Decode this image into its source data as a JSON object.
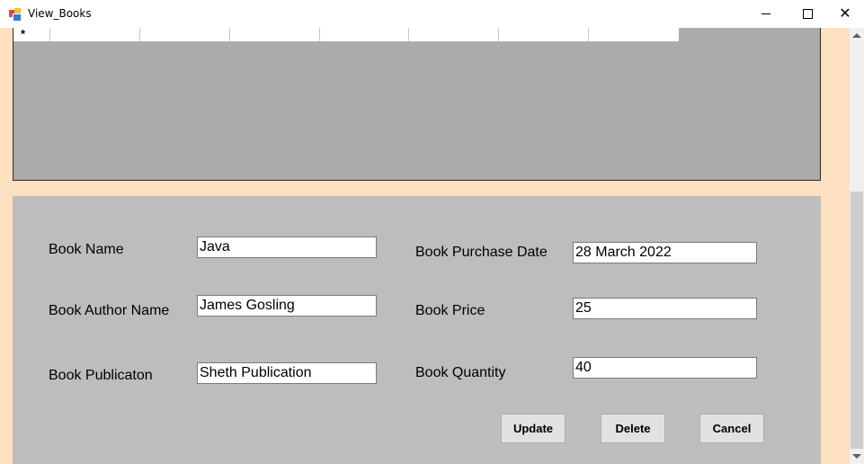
{
  "window": {
    "title": "View_Books"
  },
  "grid": {
    "new_row_marker": "*"
  },
  "form": {
    "book_name_label": "Book Name",
    "book_name_value": "Java",
    "author_label": "Book Author Name",
    "author_value": "James Gosling",
    "publication_label": "Book Publicaton",
    "publication_value": "Sheth Publication",
    "purchase_date_label": "Book Purchase Date",
    "purchase_date_value": "28 March 2022",
    "price_label": "Book Price",
    "price_value": "25",
    "quantity_label": "Book Quantity",
    "quantity_value": "40"
  },
  "buttons": {
    "update": "Update",
    "delete": "Delete",
    "cancel": "Cancel"
  },
  "icons": {
    "app": "app-icon",
    "minimize": "minimize-icon",
    "maximize": "maximize-icon",
    "close": "close-icon"
  }
}
